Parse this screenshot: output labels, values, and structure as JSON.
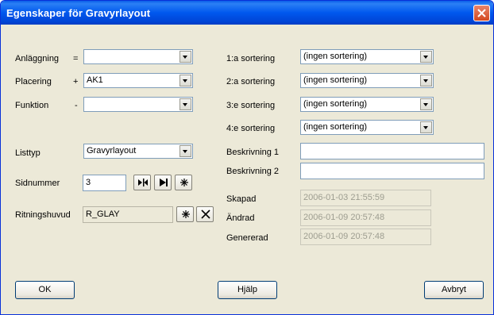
{
  "window": {
    "title": "Egenskaper för Gravyrlayout"
  },
  "left": {
    "anlaggning": {
      "label": "Anläggning",
      "op": "=",
      "value": ""
    },
    "placering": {
      "label": "Placering",
      "op": "+",
      "value": "AK1"
    },
    "funktion": {
      "label": "Funktion",
      "op": "-",
      "value": ""
    },
    "listtyp": {
      "label": "Listtyp",
      "value": "Gravyrlayout"
    },
    "sidnummer": {
      "label": "Sidnummer",
      "value": "3"
    },
    "ritningshuvud": {
      "label": "Ritningshuvud",
      "value": "R_GLAY"
    }
  },
  "right": {
    "sort1": {
      "label": "1:a sortering",
      "value": "(ingen sortering)"
    },
    "sort2": {
      "label": "2:a sortering",
      "value": "(ingen sortering)"
    },
    "sort3": {
      "label": "3:e sortering",
      "value": "(ingen sortering)"
    },
    "sort4": {
      "label": "4:e sortering",
      "value": "(ingen sortering)"
    },
    "beskrivning1": {
      "label": "Beskrivning 1",
      "value": ""
    },
    "beskrivning2": {
      "label": "Beskrivning 2",
      "value": ""
    },
    "skapad": {
      "label": "Skapad",
      "value": "2006-01-03 21:55:59"
    },
    "andrad": {
      "label": "Ändrad",
      "value": "2006-01-09 20:57:48"
    },
    "genererad": {
      "label": "Genererad",
      "value": "2006-01-09 20:57:48"
    }
  },
  "buttons": {
    "ok": "OK",
    "help": "Hjälp",
    "cancel": "Avbryt"
  },
  "icons": {
    "page_marker": "insert-page-icon",
    "next_page": "next-page-icon",
    "new": "asterisk-icon",
    "delete": "delete-x-icon",
    "close": "close-icon"
  }
}
